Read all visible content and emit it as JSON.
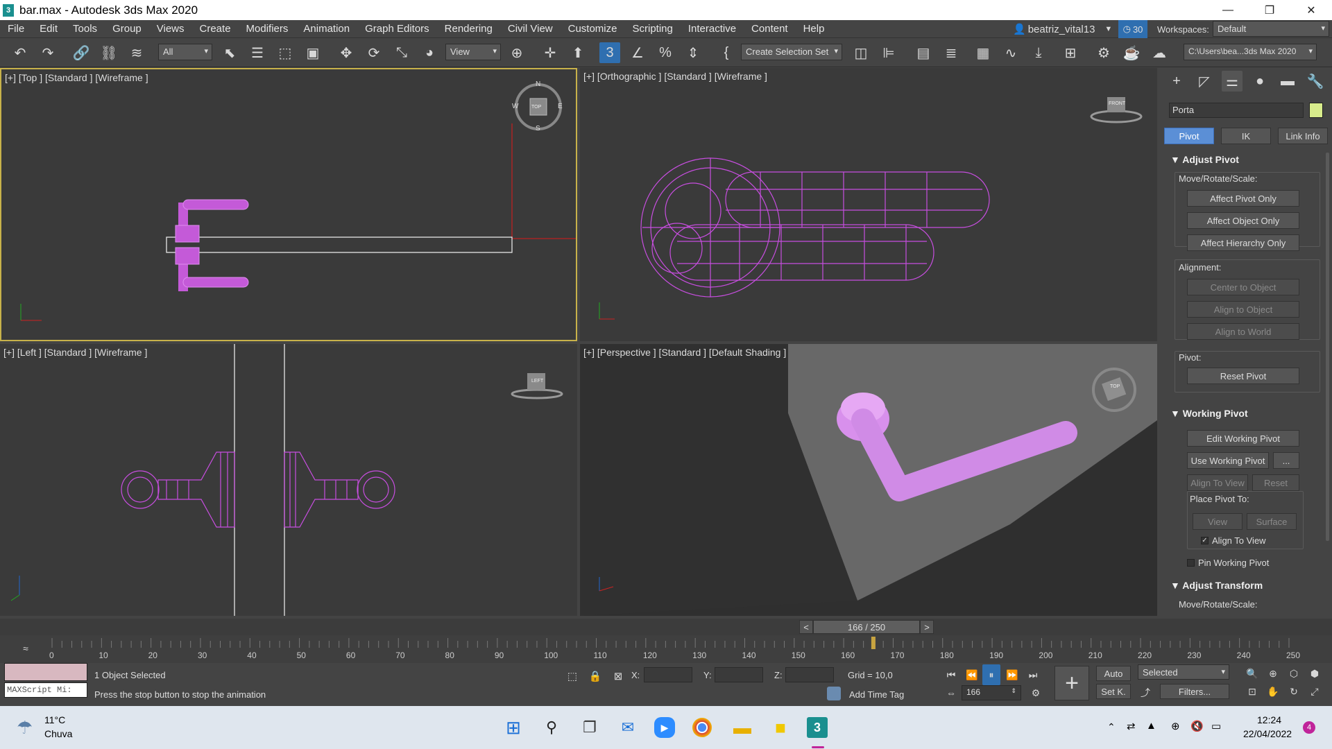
{
  "window": {
    "title": "bar.max - Autodesk 3ds Max 2020",
    "app_icon_label": "3",
    "minimize": "—",
    "restore": "❐",
    "close": "✕"
  },
  "menu": {
    "items": [
      "File",
      "Edit",
      "Tools",
      "Group",
      "Views",
      "Create",
      "Modifiers",
      "Animation",
      "Graph Editors",
      "Rendering",
      "Civil View",
      "Customize",
      "Scripting",
      "Interactive",
      "Content",
      "Help"
    ],
    "user": "beatriz_vital13",
    "badge": "30",
    "workspaces_label": "Workspaces:",
    "workspace_value": "Default"
  },
  "toolbar": {
    "filter_value": "All",
    "refcoord_value": "View",
    "selection_set": "Create Selection Set",
    "project_path": "C:\\Users\\bea...3ds Max 2020"
  },
  "viewports": {
    "top": {
      "label": "[+] [Top ] [Standard ] [Wireframe ]",
      "cube_label": "TOP",
      "compass": {
        "n": "N",
        "s": "S",
        "e": "E",
        "w": "W"
      }
    },
    "ortho": {
      "label": "[+] [Orthographic ] [Standard ] [Wireframe ]",
      "cube_label": "FRONT"
    },
    "left": {
      "label": "[+] [Left ] [Standard ] [Wireframe ]",
      "cube_label": "LEFT"
    },
    "persp": {
      "label": "[+] [Perspective ] [Standard ] [Default Shading ]",
      "cube_label": "TOP"
    }
  },
  "command_panel": {
    "object_name": "Porta",
    "object_color": "#d8ec8c",
    "tabs": {
      "pivot": "Pivot",
      "ik": "IK",
      "link_info": "Link Info"
    },
    "adjust_pivot": {
      "title": "Adjust Pivot",
      "mrs_label": "Move/Rotate/Scale:",
      "affect_pivot": "Affect Pivot Only",
      "affect_object": "Affect Object Only",
      "affect_hierarchy": "Affect Hierarchy Only",
      "alignment_label": "Alignment:",
      "center": "Center to Object",
      "align_object": "Align to Object",
      "align_world": "Align to World",
      "pivot_label": "Pivot:",
      "reset_pivot": "Reset Pivot"
    },
    "working_pivot": {
      "title": "Working Pivot",
      "edit": "Edit Working Pivot",
      "use": "Use Working Pivot",
      "more": "...",
      "align_view": "Align To View",
      "reset": "Reset",
      "place_label": "Place Pivot To:",
      "view": "View",
      "surface": "Surface",
      "align_to_view_chk": "Align To View",
      "pin": "Pin Working Pivot"
    },
    "adjust_transform": {
      "title": "Adjust Transform",
      "mrs_label": "Move/Rotate/Scale:"
    }
  },
  "timeline": {
    "frame_display": "166 / 250",
    "prev": "<",
    "next": ">",
    "current_frame": 166,
    "total_frames": 250,
    "ticks": [
      "0",
      "10",
      "20",
      "30",
      "40",
      "50",
      "60",
      "70",
      "80",
      "90",
      "100",
      "110",
      "120",
      "130",
      "140",
      "150",
      "160",
      "170",
      "180",
      "190",
      "200",
      "210",
      "220",
      "230",
      "240",
      "250"
    ]
  },
  "status": {
    "maxscript": "MAXScript Mi:",
    "selection": "1 Object Selected",
    "prompt": "Press the stop button to stop the animation",
    "x_label": "X:",
    "y_label": "Y:",
    "z_label": "Z:",
    "grid": "Grid = 10,0",
    "add_time_tag": "Add Time Tag",
    "auto": "Auto",
    "setk": "Set K.",
    "selected_value": "Selected",
    "filters": "Filters...",
    "frame_field": "166"
  },
  "taskbar": {
    "weather_temp": "11°C",
    "weather_desc": "Chuva",
    "time": "12:24",
    "date": "22/04/2022",
    "notifications": "4"
  }
}
